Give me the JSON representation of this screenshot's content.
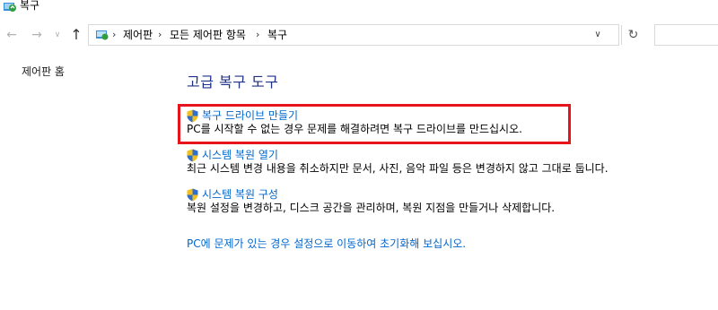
{
  "window": {
    "title": "복구"
  },
  "nav": {
    "back_icon": "arrow-left-icon",
    "forward_icon": "arrow-right-icon",
    "recent_icon": "chevron-down-icon",
    "up_icon": "arrow-up-icon",
    "refresh_icon": "refresh-icon"
  },
  "address": {
    "breadcrumbs": [
      "제어판",
      "모든 제어판 항목",
      "복구"
    ]
  },
  "sidebar": {
    "home_label": "제어판 홈"
  },
  "main": {
    "heading": "고급 복구 도구",
    "items": [
      {
        "label": "복구 드라이브 만들기",
        "description": "PC를 시작할 수 없는 경우 문제를 해결하려면 복구 드라이브를 만드십시오."
      },
      {
        "label": "시스템 복원 열기",
        "description": "최근 시스템 변경 내용을 취소하지만 문서, 사진, 음악 파일 등은 변경하지 않고 그대로 둡니다."
      },
      {
        "label": "시스템 복원 구성",
        "description": "복원 설정을 변경하고, 디스크 공간을 관리하며, 복원 지점을 만들거나 삭제합니다."
      }
    ],
    "footer_link": "PC에 문제가 있는 경우 설정으로 이동하여 초기화해 보십시오."
  },
  "colors": {
    "link": "#0066cc",
    "heading": "#1e3287",
    "highlight": "#e8141c"
  }
}
